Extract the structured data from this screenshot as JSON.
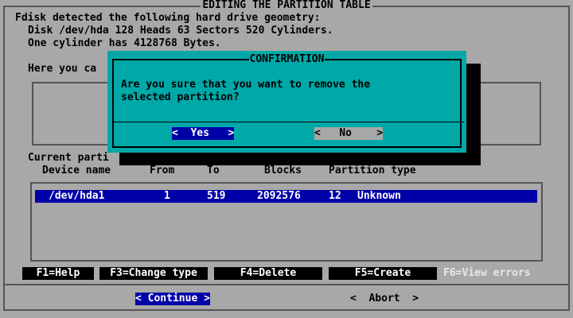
{
  "window": {
    "title": "EDITING THE PARTITION TABLE"
  },
  "info": {
    "line1": "Fdisk detected the following hard drive geometry:",
    "line2": "Disk /dev/hda 128 Heads 63 Sectors 520 Cylinders.",
    "line3": "One cylinder has 4128768 Bytes.",
    "hint": "Here you ca"
  },
  "partitions": {
    "section_label": "Current parti",
    "columns": [
      "Device name",
      "From",
      "To",
      "Blocks",
      "Partition type"
    ],
    "rows": [
      {
        "device": "/dev/hda1",
        "from": "1",
        "to": "519",
        "blocks": "2092576",
        "type_id": "12",
        "type_name": "Unknown"
      }
    ]
  },
  "fkeys": {
    "help": "F1=Help",
    "change_type": "F3=Change type",
    "delete": "F4=Delete",
    "create": "F5=Create",
    "view_errors": "F6=View errors"
  },
  "buttons": {
    "continue": "< Continue >",
    "abort": "<  Abort  >"
  },
  "dialog": {
    "title": "CONFIRMATION",
    "message_line1": "Are you sure that you want to remove the",
    "message_line2": "selected partition?",
    "yes": "<  Yes   >",
    "no": "<   No    >"
  },
  "colors": {
    "background": "#a8a8a8",
    "dialog": "#00a8a8",
    "selection": "#0000a8",
    "fkey_bg": "#000000"
  }
}
